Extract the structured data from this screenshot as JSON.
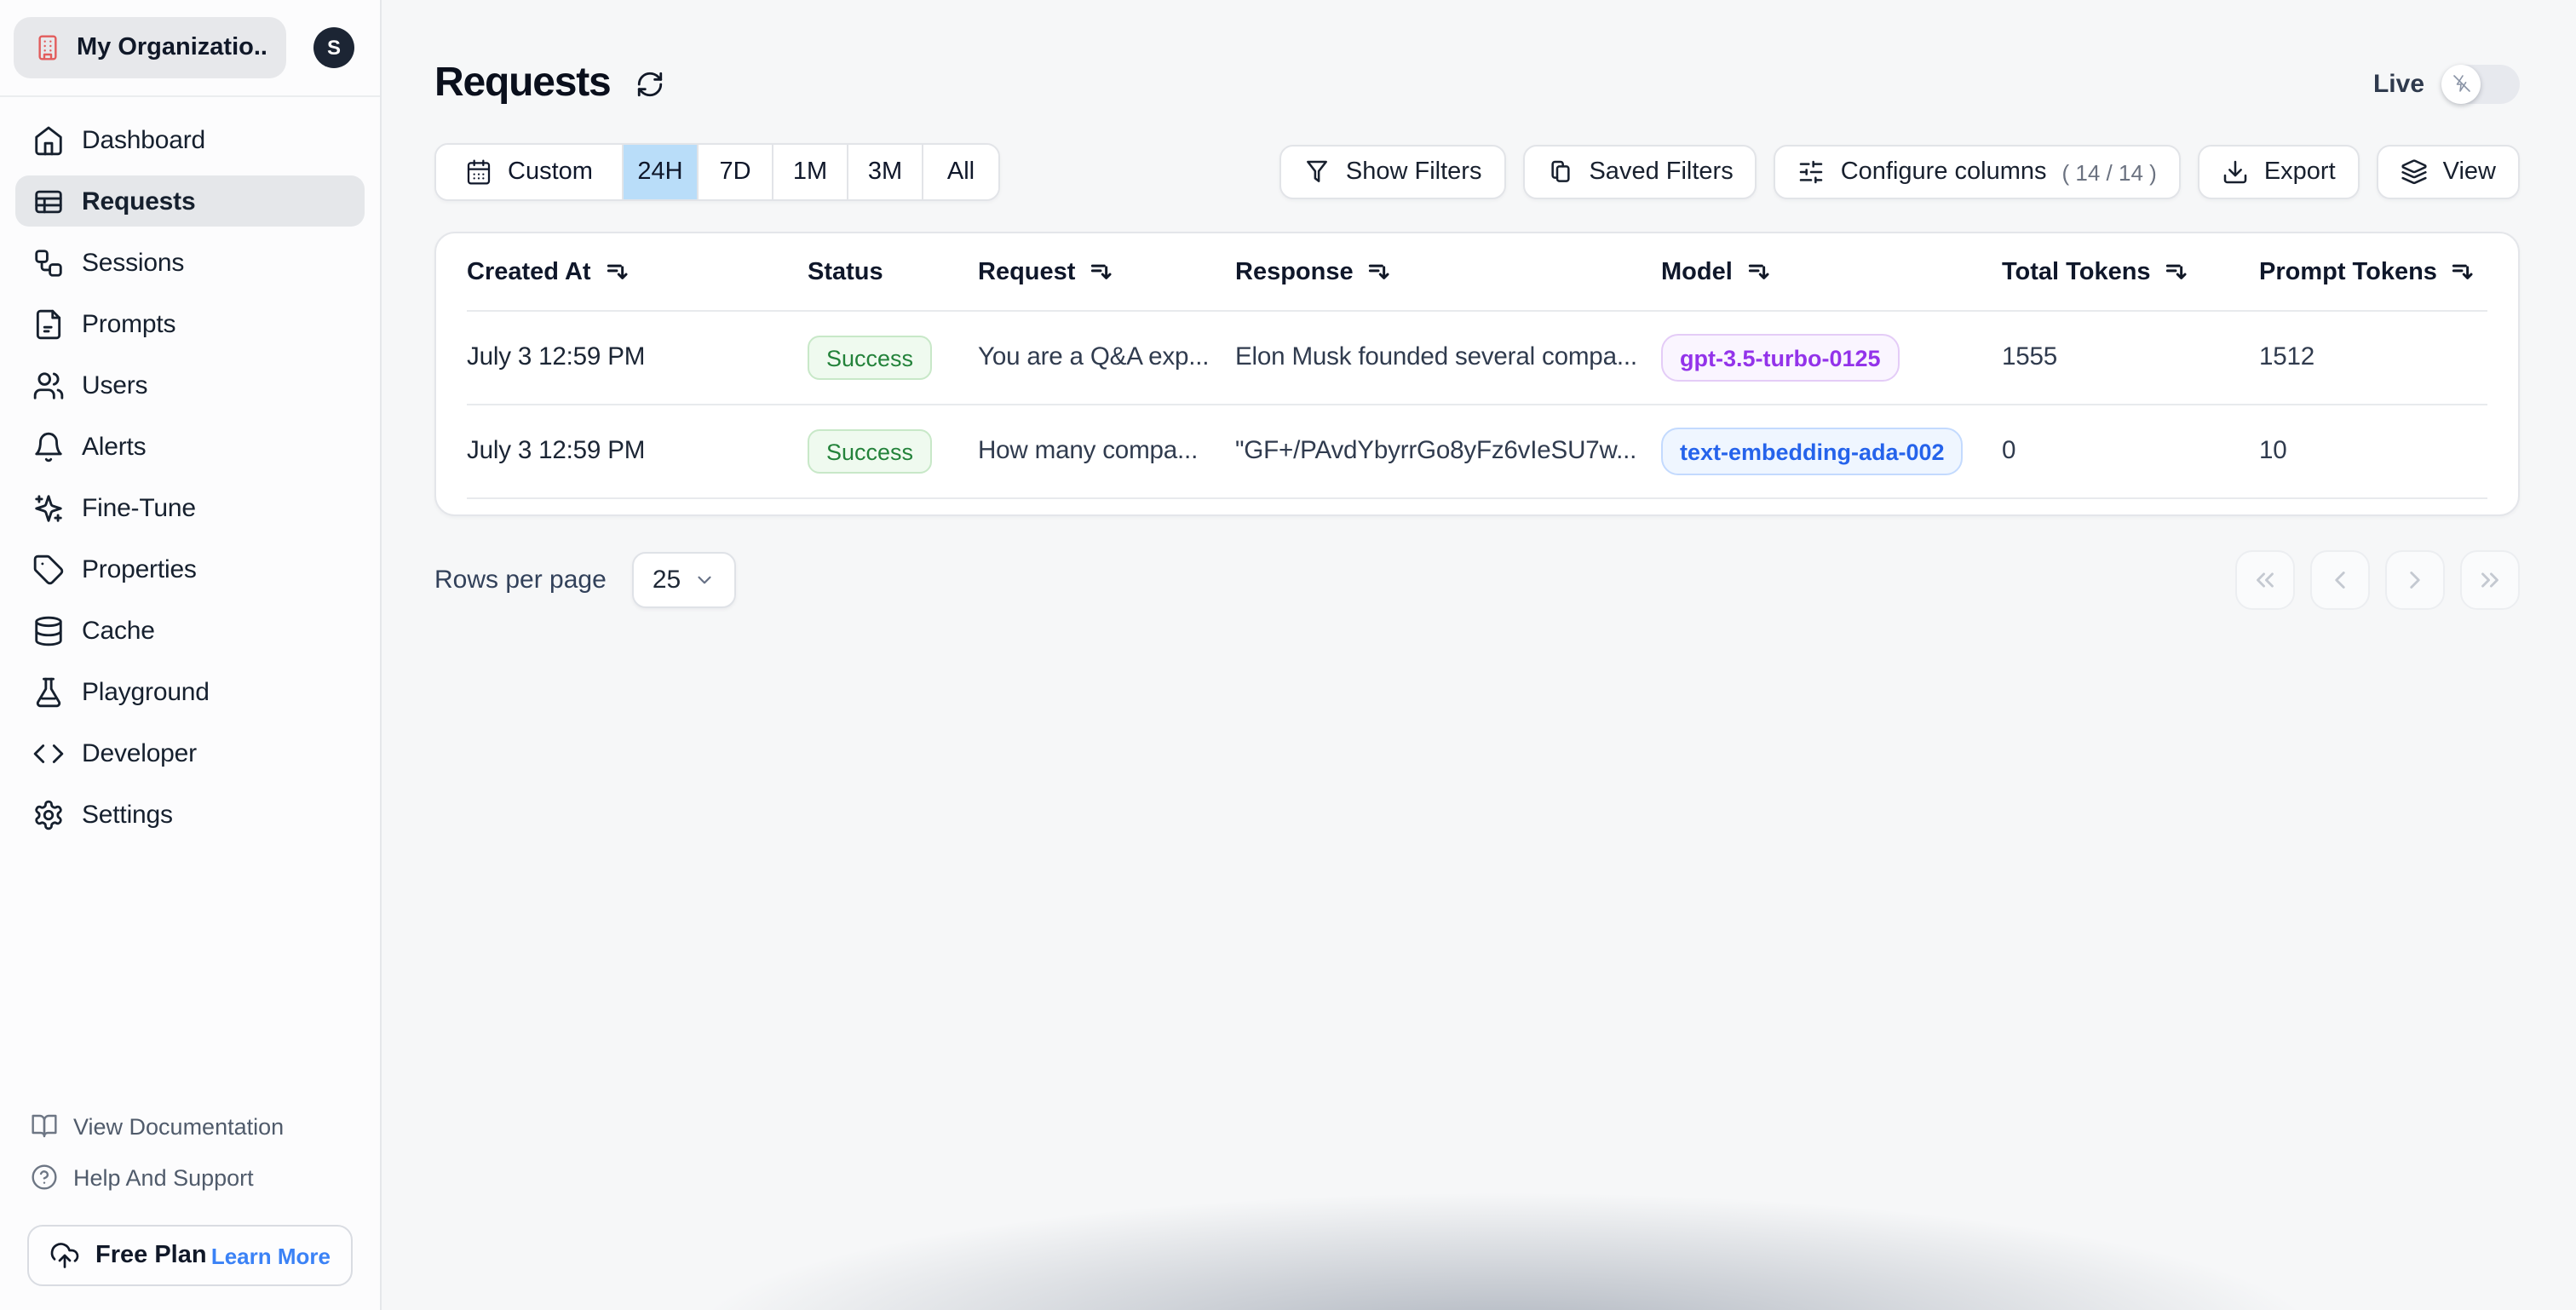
{
  "org": {
    "name": "My Organizatio...",
    "avatar_initial": "S"
  },
  "sidebar": {
    "items": [
      {
        "label": "Dashboard",
        "icon": "home-icon",
        "active": false
      },
      {
        "label": "Requests",
        "icon": "table-icon",
        "active": true
      },
      {
        "label": "Sessions",
        "icon": "workflow-icon",
        "active": false
      },
      {
        "label": "Prompts",
        "icon": "file-icon",
        "active": false
      },
      {
        "label": "Users",
        "icon": "users-icon",
        "active": false
      },
      {
        "label": "Alerts",
        "icon": "bell-icon",
        "active": false
      },
      {
        "label": "Fine-Tune",
        "icon": "sparkles-icon",
        "active": false
      },
      {
        "label": "Properties",
        "icon": "tag-icon",
        "active": false
      },
      {
        "label": "Cache",
        "icon": "database-icon",
        "active": false
      },
      {
        "label": "Playground",
        "icon": "flask-icon",
        "active": false
      },
      {
        "label": "Developer",
        "icon": "code-icon",
        "active": false
      },
      {
        "label": "Settings",
        "icon": "gear-icon",
        "active": false
      }
    ],
    "footer_links": [
      {
        "label": "View Documentation",
        "icon": "book-open-icon"
      },
      {
        "label": "Help And Support",
        "icon": "help-circle-icon"
      }
    ],
    "plan": {
      "label": "Free Plan",
      "action": "Learn More",
      "icon": "cloud-upload-icon"
    }
  },
  "header": {
    "title": "Requests",
    "live_label": "Live",
    "live_enabled": false
  },
  "toolbar": {
    "time_ranges": [
      "Custom",
      "24H",
      "7D",
      "1M",
      "3M",
      "All"
    ],
    "selected_range": "24H",
    "buttons": {
      "show_filters": "Show Filters",
      "saved_filters": "Saved Filters",
      "configure_columns": "Configure columns",
      "configure_count": "( 14 / 14 )",
      "export": "Export",
      "view": "View"
    }
  },
  "table": {
    "columns": [
      {
        "label": "Created At",
        "sortable": true
      },
      {
        "label": "Status",
        "sortable": false
      },
      {
        "label": "Request",
        "sortable": true
      },
      {
        "label": "Response",
        "sortable": true
      },
      {
        "label": "Model",
        "sortable": true
      },
      {
        "label": "Total Tokens",
        "sortable": true
      },
      {
        "label": "Prompt Tokens",
        "sortable": true
      }
    ],
    "rows": [
      {
        "created_at": "July 3 12:59 PM",
        "status": "Success",
        "request": "You are a Q&A exp...",
        "response": "Elon Musk founded several compa...",
        "model": "gpt-3.5-turbo-0125",
        "total_tokens": "1555",
        "prompt_tokens": "1512"
      },
      {
        "created_at": "July 3 12:59 PM",
        "status": "Success",
        "request": "How many compa...",
        "response": "\"GF+/PAvdYbyrrGo8yFz6vIeSU7w...",
        "model": "text-embedding-ada-002",
        "total_tokens": "0",
        "prompt_tokens": "10"
      }
    ]
  },
  "pagination": {
    "rows_per_page_label": "Rows per page",
    "rows_per_page_value": "25"
  },
  "colors": {
    "accent_selected": "#b9ddf9",
    "success_green": "#23823a",
    "model_chat_purple": "#9333ea",
    "model_embedding_blue": "#2563eb",
    "org_icon_red": "#e25c5c"
  }
}
